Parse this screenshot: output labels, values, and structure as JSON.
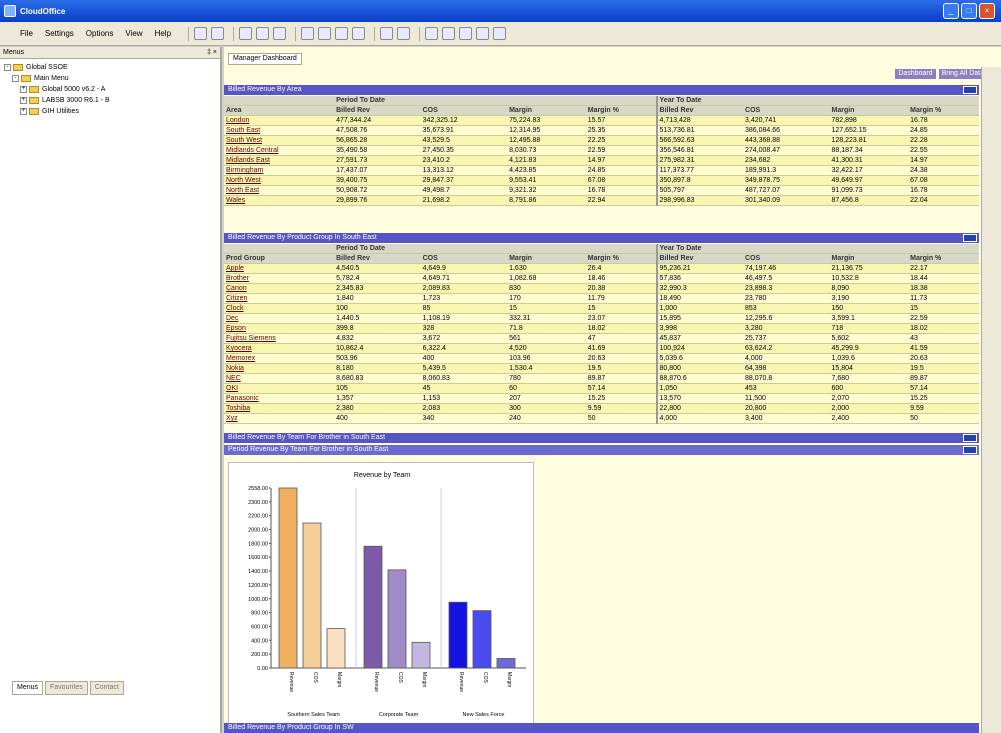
{
  "window": {
    "title": "CloudOffice"
  },
  "menubar": [
    "File",
    "Settings",
    "Options",
    "View",
    "Help"
  ],
  "leftpane": {
    "title": "Menus",
    "pin": "‡ ×",
    "tree": [
      {
        "label": "Global SSOE",
        "depth": 0,
        "pm": "-"
      },
      {
        "label": "Main Menu",
        "depth": 1,
        "pm": "-"
      },
      {
        "label": "Global 5000 v6.2 - A",
        "depth": 2,
        "pm": "+"
      },
      {
        "label": "LABSB 3000 R6.1 - B",
        "depth": 2,
        "pm": "+"
      },
      {
        "label": "GIH Utilities",
        "depth": 2,
        "pm": "+"
      }
    ],
    "tabs": [
      "Menus",
      "Favourites",
      "Contact"
    ]
  },
  "doc_tab": "Manager Dashboard",
  "dash_links": [
    "Dashboard",
    "Bring All Data"
  ],
  "sections": {
    "s1": "Billed Revenue By Area",
    "s2": "Billed Revenue By Product Group In South East",
    "s3": "Billed Revenue By Team For Brother in South East",
    "s4": "Period Revenue By Team For Brother in South East",
    "s5": "Billed Revenue By Product Group In SW"
  },
  "table1": {
    "group_headers": [
      "Period To Date",
      "Year To Date"
    ],
    "columns": [
      "Area",
      "Billed Rev",
      "COS",
      "Margin",
      "Margin %",
      "Billed Rev",
      "COS",
      "Margin",
      "Margin %"
    ],
    "rows": [
      [
        "London",
        "477,344.24",
        "342,325.12",
        "75,224.83",
        "15.57",
        "4,713,428",
        "3,420,741",
        "782,898",
        "16.78"
      ],
      [
        "South East",
        "47,508.76",
        "35,673.91",
        "12,314.95",
        "25.35",
        "513,736.81",
        "386,084.66",
        "127,652.15",
        "24.85"
      ],
      [
        "South West",
        "56,865.28",
        "43,529.5",
        "12,495.88",
        "22.25",
        "566,592.63",
        "443,368.88",
        "128,223.81",
        "22.28"
      ],
      [
        "Midlands Central",
        "35,490.58",
        "27,450.35",
        "8,030.73",
        "22.59",
        "356,546.81",
        "274,008.47",
        "88,187.34",
        "22.55"
      ],
      [
        "Midlands East",
        "27,591.73",
        "23,410.2",
        "4,121.83",
        "14.97",
        "275,982.31",
        "234,682",
        "41,300.31",
        "14.97"
      ],
      [
        "Birmingham",
        "17,437.07",
        "13,313.12",
        "4,423.85",
        "24.85",
        "117,373.77",
        "189,991.3",
        "32,422.17",
        "24.38"
      ],
      [
        "North West",
        "39,400.75",
        "29,847.37",
        "9,553.41",
        "67.08",
        "350,897.8",
        "349,878.75",
        "49,649.97",
        "67.08"
      ],
      [
        "North East",
        "50,908.72",
        "49,498.7",
        "9,321.32",
        "16.78",
        "505,797",
        "487,727.07",
        "91,099.73",
        "16.78"
      ],
      [
        "Wales",
        "29,899.76",
        "21,698.2",
        "8,791.86",
        "22.94",
        "298,996.83",
        "301,340.09",
        "87,456.8",
        "22.04"
      ]
    ]
  },
  "table2": {
    "group_headers": [
      "Period To Date",
      "Year To Date"
    ],
    "columns": [
      "Prod Group",
      "Billed Rev",
      "COS",
      "Margin",
      "Margin %",
      "Billed Rev",
      "COS",
      "Margin",
      "Margin %"
    ],
    "rows": [
      [
        "Apple",
        "4,540.5",
        "4,649.9",
        "1,630",
        "26.4",
        "95,236.21",
        "74,197.46",
        "21,136.75",
        "22.17"
      ],
      [
        "Brother",
        "5,782.4",
        "4,649.71",
        "1,082.68",
        "18.46",
        "57,836",
        "46,497.5",
        "10,532.8",
        "18.44"
      ],
      [
        "Canon",
        "2,345.83",
        "2,089.83",
        "830",
        "20.38",
        "32,990.3",
        "23,898.3",
        "8,090",
        "18.38"
      ],
      [
        "Citizen",
        "1,840",
        "1,723",
        "170",
        "11.79",
        "18,490",
        "23,780",
        "3,190",
        "11.73"
      ],
      [
        "Clock",
        "100",
        "85",
        "15",
        "15",
        "1,000",
        "853",
        "150",
        "15"
      ],
      [
        "Dec",
        "1,440.5",
        "1,108.19",
        "332.31",
        "23.07",
        "15,895",
        "12,295.6",
        "3,599.1",
        "22.59"
      ],
      [
        "Epson",
        "399.8",
        "328",
        "71.8",
        "18.02",
        "3,998",
        "3,280",
        "718",
        "18.02"
      ],
      [
        "Fujitsu Siemens",
        "4,832",
        "3,672",
        "561",
        "47",
        "45,837",
        "25,737",
        "5,602",
        "43"
      ],
      [
        "Kyocera",
        "10,862.4",
        "6,322.4",
        "4,520",
        "41.69",
        "100,924",
        "63,624.2",
        "45,299.9",
        "41.59"
      ],
      [
        "Memorex",
        "503.96",
        "400",
        "103.96",
        "20.63",
        "5,039.6",
        "4,000",
        "1,039.6",
        "20.63"
      ],
      [
        "Nokia",
        "8,180",
        "5,439.5",
        "1,530.4",
        "19.5",
        "80,800",
        "64,398",
        "15,804",
        "19.5"
      ],
      [
        "NEC",
        "8,680.83",
        "8,060.83",
        "780",
        "89.87",
        "88,870.6",
        "88,070.8",
        "7,680",
        "89.87"
      ],
      [
        "OKI",
        "105",
        "45",
        "60",
        "57.14",
        "1,050",
        "453",
        "600",
        "57.14"
      ],
      [
        "Panasonic",
        "1,357",
        "1,153",
        "207",
        "15.25",
        "13,570",
        "11,500",
        "2,070",
        "15.25"
      ],
      [
        "Toshiba",
        "2,380",
        "2,083",
        "300",
        "9.59",
        "22,800",
        "20,800",
        "2,000",
        "9.59"
      ],
      [
        "Xyz",
        "400",
        "340",
        "240",
        "50",
        "4,000",
        "3,400",
        "2,400",
        "50"
      ]
    ]
  },
  "chart_data": {
    "type": "bar",
    "title": "Revenue by Team",
    "categories": [
      "Southern Sales Team",
      "Corporate Team",
      "New Sales Force"
    ],
    "series_labels": [
      "Revenue",
      "COS",
      "Margin"
    ],
    "values": [
      [
        2558,
        2060,
        560
      ],
      [
        1730,
        1395,
        365
      ],
      [
        935,
        815,
        135
      ]
    ],
    "colors": [
      [
        "#f0b060",
        "#f5cf98",
        "#f8e0c0"
      ],
      [
        "#7d5aa8",
        "#a08ac8",
        "#c4b6e0"
      ],
      [
        "#1414e0",
        "#4a4af0",
        "#6a6ad8"
      ]
    ],
    "ylim": [
      0,
      2558
    ],
    "yticks": [
      "2558.00",
      "2300.00",
      "2200.00",
      "2000.00",
      "1800.00",
      "1600.00",
      "1400.00",
      "1200.00",
      "1000.00",
      "800.00",
      "600.00",
      "400.00",
      "200.00",
      "0.00"
    ]
  }
}
